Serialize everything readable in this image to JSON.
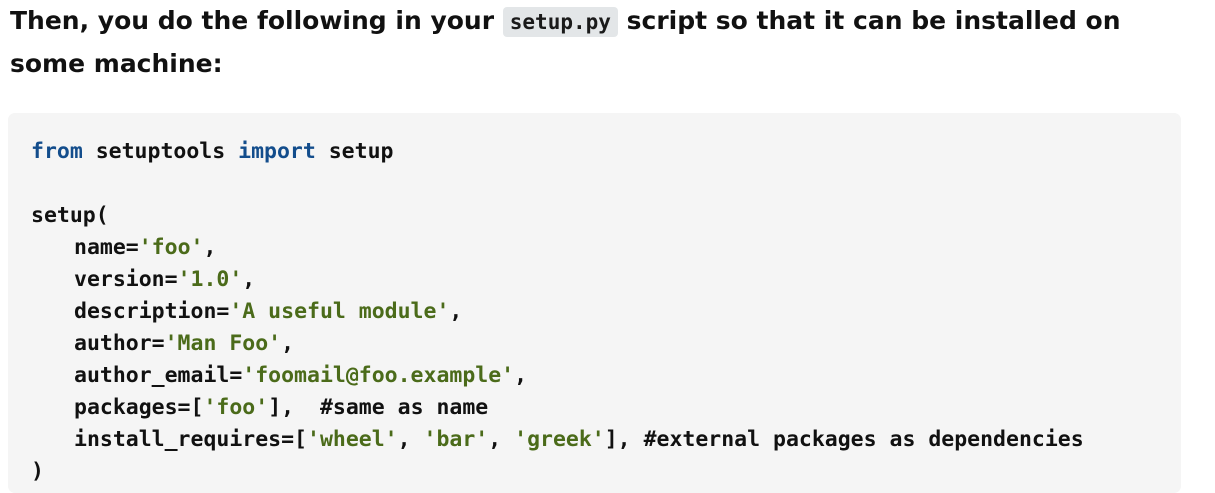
{
  "intro": {
    "before": "Then, you do the following in your ",
    "code": "setup.py",
    "after": " script so that it can be installed on some machine:"
  },
  "code": {
    "l1": {
      "kw1": "from",
      "mod": " setuptools ",
      "kw2": "import",
      "name": " setup"
    },
    "l3": {
      "text": "setup("
    },
    "l4": {
      "key": "name=",
      "val": "'foo'",
      "end": ","
    },
    "l5": {
      "key": "version=",
      "val": "'1.0'",
      "end": ","
    },
    "l6": {
      "key": "description=",
      "val": "'A useful module'",
      "end": ","
    },
    "l7": {
      "key": "author=",
      "val": "'Man Foo'",
      "end": ","
    },
    "l8": {
      "key": "author_email=",
      "val": "'foomail@foo.example'",
      "end": ","
    },
    "l9": {
      "key": "packages=[",
      "val": "'foo'",
      "end": "],  #same as name"
    },
    "l10": {
      "key": "install_requires=[",
      "v1": "'wheel'",
      "s1": ", ",
      "v2": "'bar'",
      "s2": ", ",
      "v3": "'greek'",
      "end": "], #external packages as dependencies"
    },
    "l11": {
      "text": ")"
    }
  }
}
